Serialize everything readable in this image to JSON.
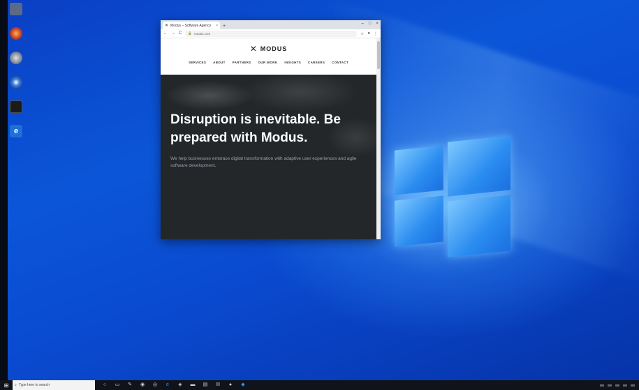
{
  "desktop": {
    "icons": [
      {
        "name": "recycle-bin-icon"
      },
      {
        "name": "firefox-icon"
      },
      {
        "name": "chrome-icon"
      },
      {
        "name": "media-player-icon"
      },
      {
        "name": "terminal-icon"
      },
      {
        "name": "edge-icon",
        "glyph": "e"
      }
    ]
  },
  "browser": {
    "tab": {
      "title": "Modus – Software Agency",
      "close": "×"
    },
    "new_tab": "+",
    "window_controls": {
      "minimize": "–",
      "maximize": "□",
      "close": "×"
    },
    "nav_back": "←",
    "nav_forward": "→",
    "reload": "C",
    "url": "modus.com",
    "star": "☆",
    "account": "●",
    "menu": "⋮"
  },
  "site": {
    "logo_mark": "✕",
    "logo_text": "MODUS",
    "nav": [
      "SERVICES",
      "ABOUT",
      "PARTNERS",
      "OUR WORK",
      "INSIGHTS",
      "CAREERS",
      "CONTACT"
    ],
    "hero_title": "Disruption is inevitable. Be prepared with Modus.",
    "hero_subtitle": "We help businesses embrace digital transformation with adaptive user experiences and agile software development."
  },
  "taskbar": {
    "start_glyph": "⊞",
    "search_placeholder": "Type here to search",
    "pinned": [
      {
        "name": "cortana-icon",
        "glyph": "○"
      },
      {
        "name": "task-view-icon",
        "glyph": "▭"
      },
      {
        "name": "paint-icon",
        "glyph": "✎"
      },
      {
        "name": "firefox-taskbar-icon",
        "glyph": "◉"
      },
      {
        "name": "chrome-taskbar-icon",
        "glyph": "◎"
      },
      {
        "name": "edge-taskbar-icon",
        "glyph": "e"
      },
      {
        "name": "media-taskbar-icon",
        "glyph": "◈"
      },
      {
        "name": "terminal-taskbar-icon",
        "glyph": "▬"
      },
      {
        "name": "store-icon",
        "glyph": "▤"
      },
      {
        "name": "mail-icon",
        "glyph": "✉"
      },
      {
        "name": "music-icon",
        "glyph": "●"
      },
      {
        "name": "dropbox-icon",
        "glyph": "◆"
      }
    ]
  }
}
